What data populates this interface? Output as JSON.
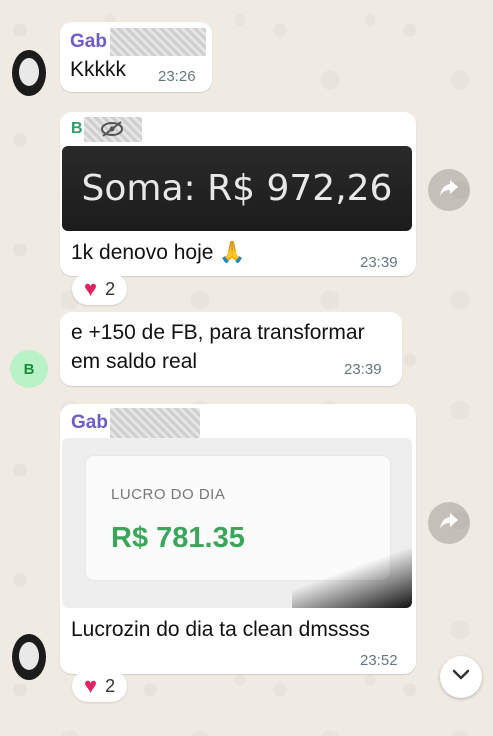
{
  "messages": [
    {
      "sender": "Gab",
      "text": "Kkkkk",
      "time": "23:26"
    },
    {
      "sender": "B",
      "image_text": "Soma:  R$ 972,26",
      "text": "1k denovo hoje 🙏",
      "time": "23:39",
      "reaction_count": "2"
    },
    {
      "avatar_letter": "B",
      "text_lines": [
        "e +150 de FB, para transformar",
        "em saldo real"
      ],
      "time": "23:39"
    },
    {
      "sender": "Gab",
      "card_label": "LUCRO DO DIA",
      "card_value": "R$ 781.35",
      "text": "Lucrozin do dia ta clean dmssss",
      "time": "23:52",
      "reaction_count": "2"
    }
  ],
  "colors": {
    "sender_name": "#6e5cc7",
    "sender_name_b": "#2b9e6b",
    "profit_green": "#3ba55c",
    "wallpaper": "#efeae2"
  },
  "icons": {
    "forward": "forward-icon",
    "scroll": "chevron-down-icon",
    "hidden": "eye-slash-icon",
    "heart": "heart-icon"
  }
}
